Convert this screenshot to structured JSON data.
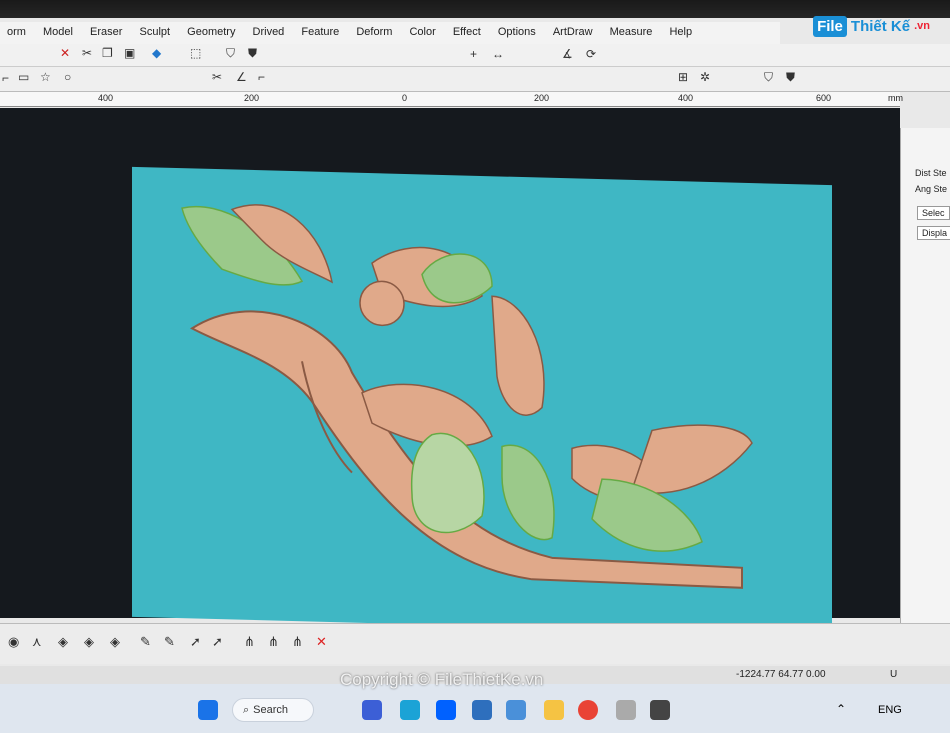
{
  "menu": [
    "orm",
    "Model",
    "Eraser",
    "Sculpt",
    "Geometry",
    "Drived",
    "Feature",
    "Deform",
    "Color",
    "Effect",
    "Options",
    "ArtDraw",
    "Measure",
    "Help"
  ],
  "logo": {
    "part1": "File",
    "part2": "Thiết Kế",
    ".vn": ".vn"
  },
  "ruler": {
    "l400": "400",
    "l200": "200",
    "l0": "0",
    "r200": "200",
    "r400": "400",
    "r600": "600",
    "unit": "mm"
  },
  "panel": {
    "dist": "Dist Ste",
    "ang": "Ang Ste",
    "select": "Selec",
    "display": "Displa"
  },
  "status": {
    "coords": "-1224.77 64.77 0.00",
    "u": "U"
  },
  "taskbar": {
    "search": "Search",
    "lang": "ENG"
  },
  "watermark": "Copyright © FileThietKe.vn",
  "colors": {
    "canvas": "#3fb7c4",
    "carving": "#e0a98a",
    "leaf": "#9bc98a"
  }
}
